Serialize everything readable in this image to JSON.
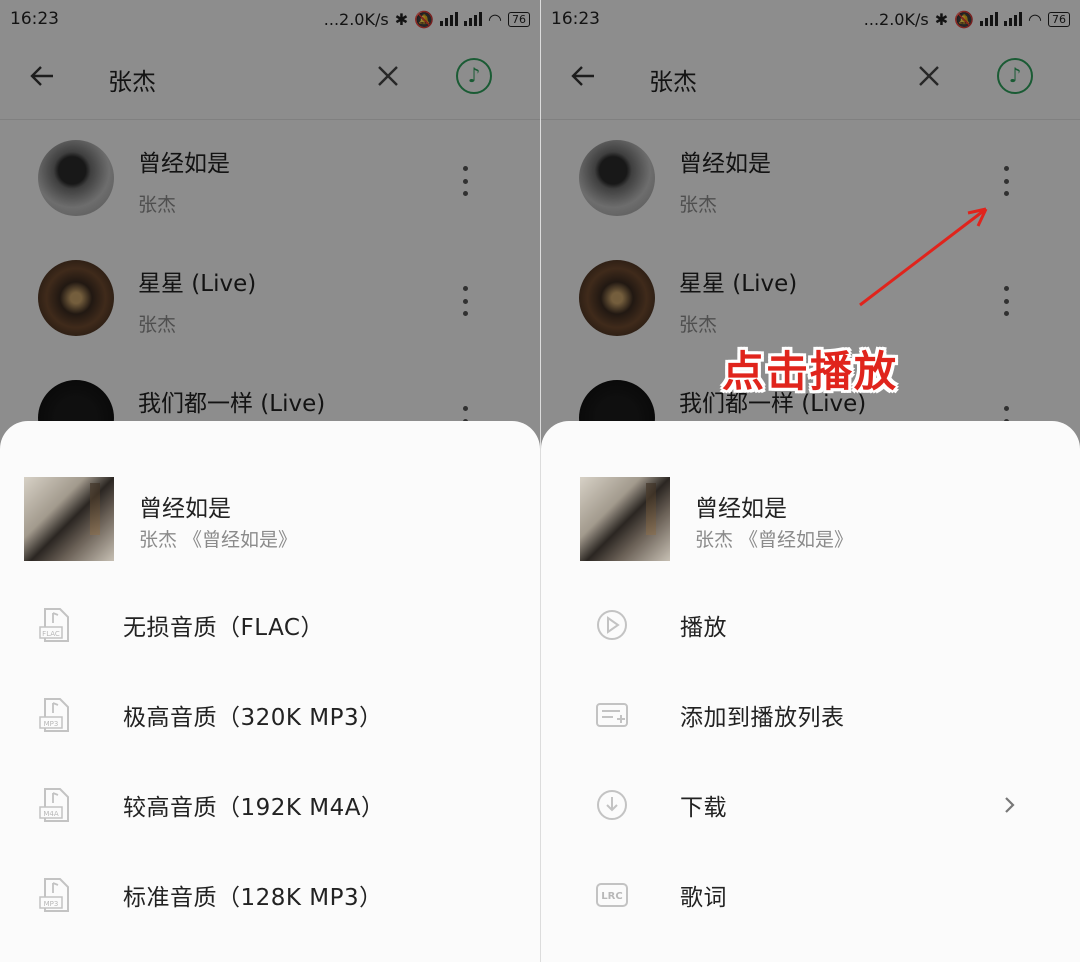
{
  "status_bar": {
    "time": "16:23",
    "network_speed": "...2.0K/s",
    "battery": "76"
  },
  "toolbar": {
    "query": "张杰"
  },
  "results": [
    {
      "title": "曾经如是",
      "artist": "张杰"
    },
    {
      "title": "星星 (Live)",
      "artist": "张杰"
    },
    {
      "title": "我们都一样 (Live)",
      "artist": ""
    }
  ],
  "sheet": {
    "song_title": "曾经如是",
    "song_subtitle": "张杰 《曾经如是》"
  },
  "quality_menu": [
    {
      "label": "无损音质（FLAC）",
      "icon": "flac-file-icon"
    },
    {
      "label": "极高音质（320K MP3）",
      "icon": "mp3-file-icon"
    },
    {
      "label": "较高音质（192K M4A）",
      "icon": "m4a-file-icon"
    },
    {
      "label": "标准音质（128K MP3）",
      "icon": "mp3-file-icon"
    }
  ],
  "action_menu": [
    {
      "label": "播放",
      "icon": "play-circle-icon"
    },
    {
      "label": "添加到播放列表",
      "icon": "add-to-playlist-icon"
    },
    {
      "label": "下载",
      "icon": "download-icon"
    },
    {
      "label": "歌词",
      "icon": "lrc-lyrics-icon"
    }
  ],
  "annotation": {
    "callout_text": "点击播放",
    "color": "#e0241c"
  },
  "colors": {
    "accent_green": "#2e9e5b"
  }
}
